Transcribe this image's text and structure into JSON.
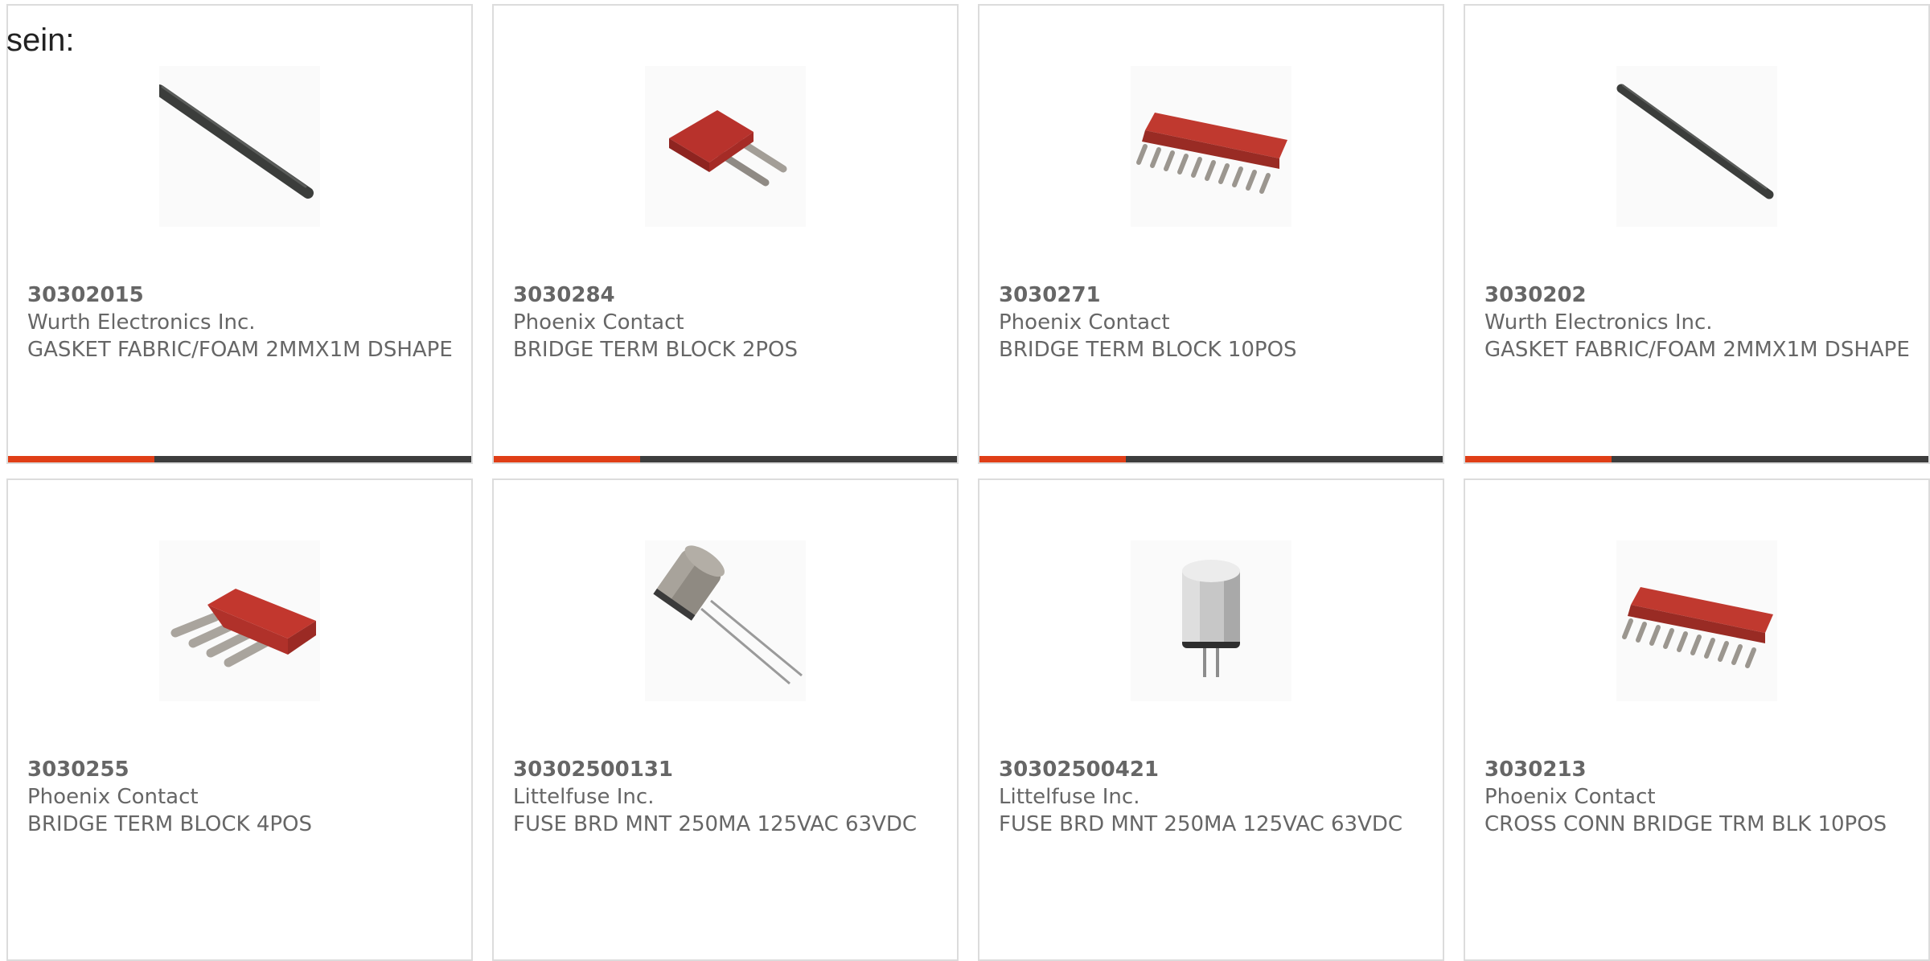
{
  "intro_text": "sein:",
  "colors": {
    "accent": "#e03e17",
    "bar": "#3d3d3d",
    "text": "#666666",
    "border": "#dcdcdc"
  },
  "products": [
    {
      "part_number": "30302015",
      "manufacturer": "Wurth Electronics Inc.",
      "description": "GASKET FABRIC/FOAM 2MMX1M DSHAPE",
      "image": "black-gasket-strip"
    },
    {
      "part_number": "3030284",
      "manufacturer": "Phoenix Contact",
      "description": "BRIDGE TERM BLOCK 2POS",
      "image": "red-bridge-2pos"
    },
    {
      "part_number": "3030271",
      "manufacturer": "Phoenix Contact",
      "description": "BRIDGE TERM BLOCK 10POS",
      "image": "red-bridge-10pos"
    },
    {
      "part_number": "3030202",
      "manufacturer": "Wurth Electronics Inc.",
      "description": "GASKET FABRIC/FOAM 2MMX1M DSHAPE",
      "image": "black-gasket-strip"
    },
    {
      "part_number": "3030255",
      "manufacturer": "Phoenix Contact",
      "description": "BRIDGE TERM BLOCK 4POS",
      "image": "red-bridge-4pos"
    },
    {
      "part_number": "30302500131",
      "manufacturer": "Littelfuse Inc.",
      "description": "FUSE BRD MNT 250MA 125VAC 63VDC",
      "image": "radial-fuse"
    },
    {
      "part_number": "30302500421",
      "manufacturer": "Littelfuse Inc.",
      "description": "FUSE BRD MNT 250MA 125VAC 63VDC",
      "image": "cylinder-fuse"
    },
    {
      "part_number": "3030213",
      "manufacturer": "Phoenix Contact",
      "description": "CROSS CONN BRIDGE TRM BLK 10POS",
      "image": "red-bridge-10pos"
    }
  ]
}
